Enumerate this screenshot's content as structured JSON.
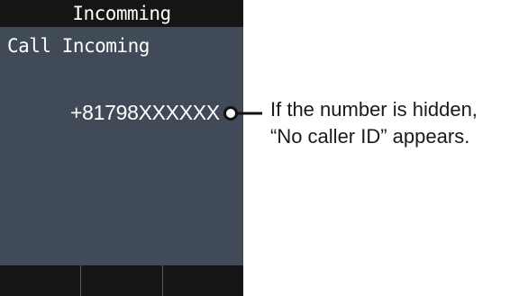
{
  "screen": {
    "title": "Incomming",
    "heading": "Call Incoming",
    "caller_number": "+81798XXXXXX",
    "softkeys": [
      "",
      "",
      ""
    ],
    "colors": {
      "screen_bg": "#414b57",
      "bar_bg": "#151515",
      "text": "#ffffff"
    }
  },
  "callout": {
    "line1": "If the number is hidden,",
    "line2": "“No caller ID” appears."
  }
}
